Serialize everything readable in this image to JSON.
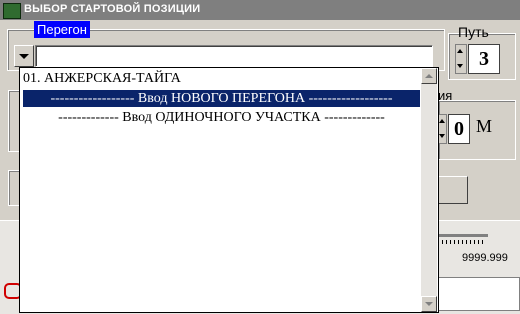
{
  "window": {
    "title": "ВЫБОР СТАРТОВОЙ ПОЗИЦИИ"
  },
  "peregon": {
    "label": "Перегон",
    "input_value": ""
  },
  "path": {
    "label": "Путь",
    "value": "3"
  },
  "position": {
    "partial_label": "ия",
    "value": "0",
    "unit": "М"
  },
  "dropdown": {
    "items": [
      {
        "label": "01. АНЖЕРСКАЯ-ТАЙГА"
      },
      {
        "label": "------------------  Ввод  НОВОГО ПЕРЕГОНА  ------------------"
      },
      {
        "label": "-------------  Ввод ОДИНОЧНОГО УЧАСТКА  -------------"
      }
    ],
    "selected_index": 1
  },
  "scale": {
    "value_label": "9999.999"
  },
  "colors": {
    "selection": "#0a246a",
    "title_bar": "#7f7f7f",
    "label_highlight": "#0000ff"
  }
}
